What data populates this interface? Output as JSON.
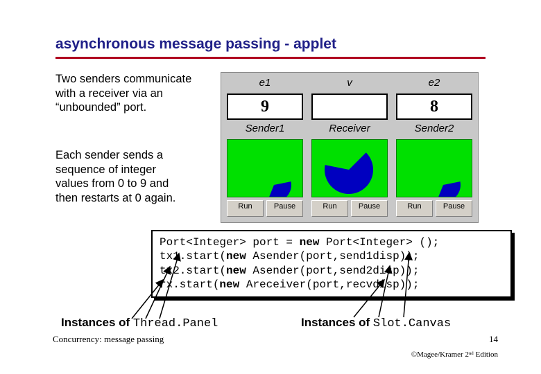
{
  "title": "asynchronous message passing - applet",
  "para1": "Two senders communicate with a receiver via an “unbounded” port.",
  "para2": "Each sender sends a sequence of integer values from 0 to 9 and then restarts at 0 again.",
  "applet": {
    "columns": [
      {
        "top": "e1",
        "value": "9",
        "name": "Sender1"
      },
      {
        "top": "v",
        "value": "",
        "name": "Receiver"
      },
      {
        "top": "e2",
        "value": "8",
        "name": "Sender2"
      }
    ],
    "buttons": {
      "run": "Run",
      "pause": "Pause"
    }
  },
  "code": {
    "l1a": "Port<Integer> port = ",
    "l1b": "new",
    "l1c": " Port<Integer> ();",
    "l2a": "tx1.start(",
    "l2b": "new",
    "l2c": " Asender(port,send1disp));",
    "l3a": "tx2.start(",
    "l3b": "new",
    "l3c": " Asender(port,send2disp));",
    "l4a": "rx.start(",
    "l4b": "new",
    "l4c": " Areceiver(port,recvdisp));"
  },
  "captions": {
    "left_bold": "Instances of ",
    "left_mono": "Thread.Panel",
    "right_bold": "Instances of ",
    "right_mono": "Slot.Canvas"
  },
  "footer": {
    "left": "Concurrency: message passing",
    "page": "14",
    "right": "©Magee/Kramer 2ⁿᵈ Edition"
  }
}
